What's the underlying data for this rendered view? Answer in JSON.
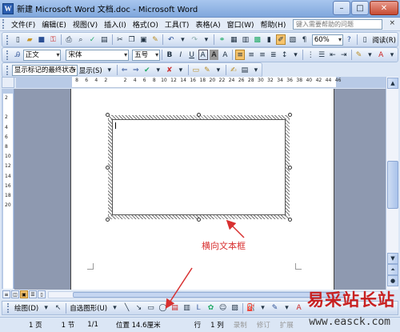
{
  "window": {
    "title": "新建 Microsoft Word 文档.doc - Microsoft Word"
  },
  "menu": {
    "items": [
      "文件(F)",
      "编辑(E)",
      "视图(V)",
      "插入(I)",
      "格式(O)",
      "工具(T)",
      "表格(A)",
      "窗口(W)",
      "帮助(H)"
    ],
    "ask_placeholder": "键入需要帮助的问题",
    "close_glyph": "×"
  },
  "standard_toolbar": {
    "zoom": "60%",
    "read_label": "阅读(R)"
  },
  "format_toolbar": {
    "style": "正文",
    "font": "宋体",
    "size": "五号",
    "bold": "B",
    "italic": "I",
    "underline": "U",
    "a_glyph": "A"
  },
  "review_toolbar": {
    "markup": "显示标记的最终状态",
    "show": "显示(S)"
  },
  "ruler": {
    "h_numbers": [
      "8",
      "6",
      "4",
      "2",
      "",
      "2",
      "4",
      "6",
      "8",
      "10",
      "12",
      "14",
      "16",
      "18",
      "20",
      "22",
      "24",
      "26",
      "28",
      "30",
      "32",
      "34",
      "36",
      "38",
      "40",
      "42",
      "44",
      "46"
    ],
    "v_numbers": [
      "2",
      "",
      "2",
      "4",
      "6",
      "8",
      "10",
      "12",
      "14",
      "16",
      "18",
      "20",
      "",
      "",
      "",
      "",
      "",
      ""
    ]
  },
  "drawing_toolbar": {
    "draw_label": "绘图(D)",
    "autoshape_label": "自选图形(U)"
  },
  "statusbar": {
    "page": "1 页",
    "section": "1 节",
    "page_of": "1/1",
    "position": "位置 14.6厘米",
    "line": "行",
    "column": "1 列",
    "rec": "录制",
    "trk": "修订",
    "ext": "扩展"
  },
  "annotation": {
    "label": "横向文本框"
  },
  "watermark": {
    "cn": "易采站长站",
    "en": "www.easck.com"
  },
  "colors": {
    "annotation": "#d83030",
    "watermark": "#c82020"
  }
}
